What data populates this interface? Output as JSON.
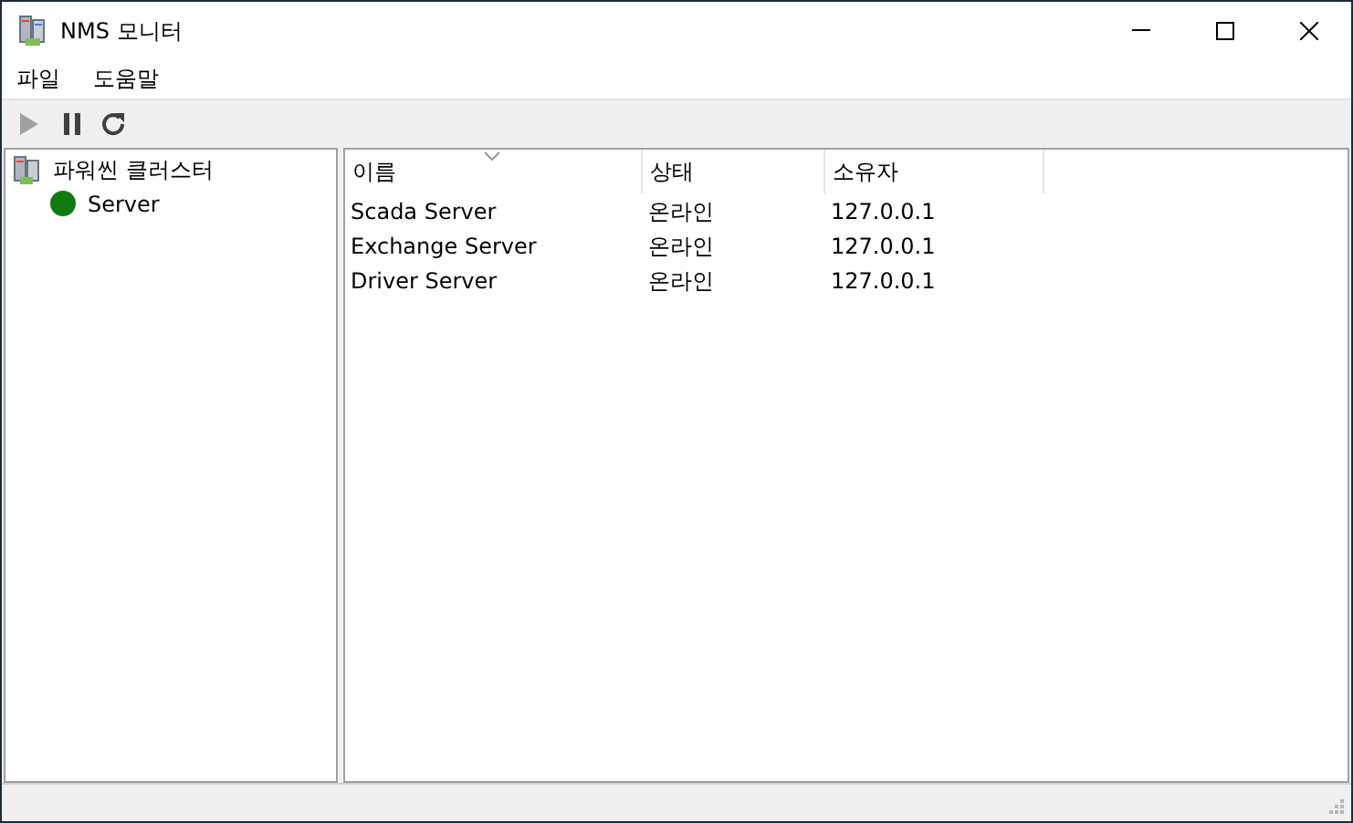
{
  "window": {
    "title": "NMS 모니터"
  },
  "menu": [
    "파일",
    "도움말"
  ],
  "toolbar": [
    {
      "kind": "play",
      "disabled": true
    },
    {
      "kind": "pause",
      "disabled": false
    },
    {
      "kind": "refresh",
      "disabled": false
    }
  ],
  "tree": [
    {
      "label": "파워씬 클러스터",
      "kind": "cluster",
      "children": [
        {
          "label": "Server",
          "kind": "status",
          "color": "#107c10"
        }
      ]
    }
  ],
  "table": {
    "columns": [
      {
        "label": "이름",
        "sorted": true
      },
      {
        "label": "상태",
        "sorted": false
      },
      {
        "label": "소유자",
        "sorted": false
      }
    ],
    "rows": [
      [
        "Scada Server",
        "온라인",
        "127.0.0.1"
      ],
      [
        "Exchange Server",
        "온라인",
        "127.0.0.1"
      ],
      [
        "Driver Server",
        "온라인",
        "127.0.0.1"
      ]
    ]
  }
}
